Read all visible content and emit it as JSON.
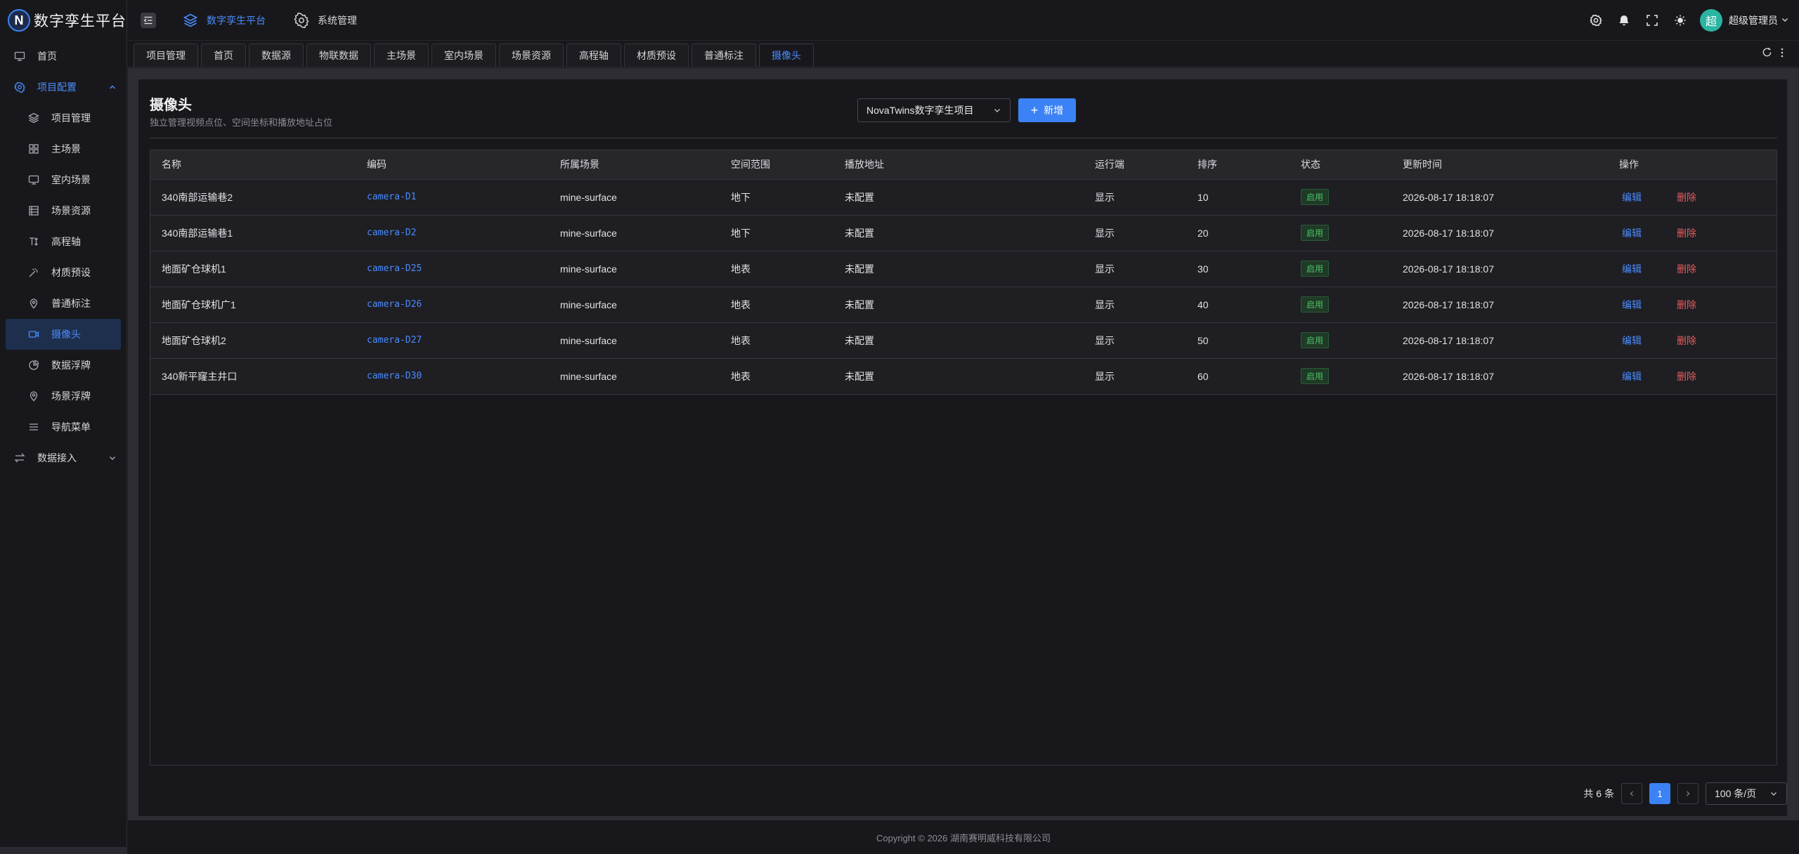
{
  "app": {
    "logo_letter": "N",
    "title": "数字孪生平台"
  },
  "header": {
    "menus": [
      {
        "label": "数字孪生平台",
        "icon": "layers-icon"
      },
      {
        "label": "系统管理",
        "icon": "gear-icon"
      }
    ],
    "user": {
      "avatar_letter": "超",
      "name": "超级管理员"
    }
  },
  "sidebar": {
    "items": [
      {
        "label": "首页",
        "icon": "monitor-icon"
      },
      {
        "label": "项目配置",
        "icon": "gear-icon"
      },
      {
        "label": "项目管理",
        "icon": "layers-icon"
      },
      {
        "label": "主场景",
        "icon": "grid-icon"
      },
      {
        "label": "室内场景",
        "icon": "monitor-icon"
      },
      {
        "label": "场景资源",
        "icon": "list-icon"
      },
      {
        "label": "高程轴",
        "icon": "elevation-icon"
      },
      {
        "label": "材质预设",
        "icon": "wand-icon"
      },
      {
        "label": "普通标注",
        "icon": "pin-icon"
      },
      {
        "label": "摄像头",
        "icon": "camera-icon"
      },
      {
        "label": "数据浮牌",
        "icon": "chart-icon"
      },
      {
        "label": "场景浮牌",
        "icon": "pin-icon"
      },
      {
        "label": "导航菜单",
        "icon": "menu-icon"
      },
      {
        "label": "数据接入",
        "icon": "swap-icon"
      }
    ]
  },
  "tabs": [
    "项目管理",
    "首页",
    "数据源",
    "物联数据",
    "主场景",
    "室内场景",
    "场景资源",
    "高程轴",
    "材质预设",
    "普通标注",
    "摄像头"
  ],
  "page": {
    "title": "摄像头",
    "subtitle": "独立管理视频点位、空间坐标和播放地址占位",
    "project_select": "NovaTwins数字孪生项目",
    "add_label": "新增"
  },
  "table": {
    "columns": [
      "名称",
      "编码",
      "所属场景",
      "空间范围",
      "播放地址",
      "运行端",
      "排序",
      "状态",
      "更新时间",
      "操作"
    ],
    "rows": [
      {
        "name": "340南部运输巷2",
        "code": "camera-D1",
        "scene": "mine-surface",
        "range": "地下",
        "url": "未配置",
        "runtime": "显示",
        "order": "10",
        "status": "启用",
        "updated": "2026-08-17 18:18:07",
        "edit": "编辑",
        "delete": "删除"
      },
      {
        "name": "340南部运输巷1",
        "code": "camera-D2",
        "scene": "mine-surface",
        "range": "地下",
        "url": "未配置",
        "runtime": "显示",
        "order": "20",
        "status": "启用",
        "updated": "2026-08-17 18:18:07",
        "edit": "编辑",
        "delete": "删除"
      },
      {
        "name": "地面矿仓球机1",
        "code": "camera-D25",
        "scene": "mine-surface",
        "range": "地表",
        "url": "未配置",
        "runtime": "显示",
        "order": "30",
        "status": "启用",
        "updated": "2026-08-17 18:18:07",
        "edit": "编辑",
        "delete": "删除"
      },
      {
        "name": "地面矿仓球机广1",
        "code": "camera-D26",
        "scene": "mine-surface",
        "range": "地表",
        "url": "未配置",
        "runtime": "显示",
        "order": "40",
        "status": "启用",
        "updated": "2026-08-17 18:18:07",
        "edit": "编辑",
        "delete": "删除"
      },
      {
        "name": "地面矿仓球机2",
        "code": "camera-D27",
        "scene": "mine-surface",
        "range": "地表",
        "url": "未配置",
        "runtime": "显示",
        "order": "50",
        "status": "启用",
        "updated": "2026-08-17 18:18:07",
        "edit": "编辑",
        "delete": "删除"
      },
      {
        "name": "340新平窿主井口",
        "code": "camera-D30",
        "scene": "mine-surface",
        "range": "地表",
        "url": "未配置",
        "runtime": "显示",
        "order": "60",
        "status": "启用",
        "updated": "2026-08-17 18:18:07",
        "edit": "编辑",
        "delete": "删除"
      }
    ]
  },
  "pagination": {
    "total_text": "共 6 条",
    "current_page": "1",
    "page_size": "100 条/页"
  },
  "footer": {
    "copyright": "Copyright © 2026 湖南赛明威科技有限公司"
  },
  "colors": {
    "accent": "#3b82f6",
    "success": "#4ec26a",
    "danger": "#e85c5c",
    "background": "#18181c"
  }
}
